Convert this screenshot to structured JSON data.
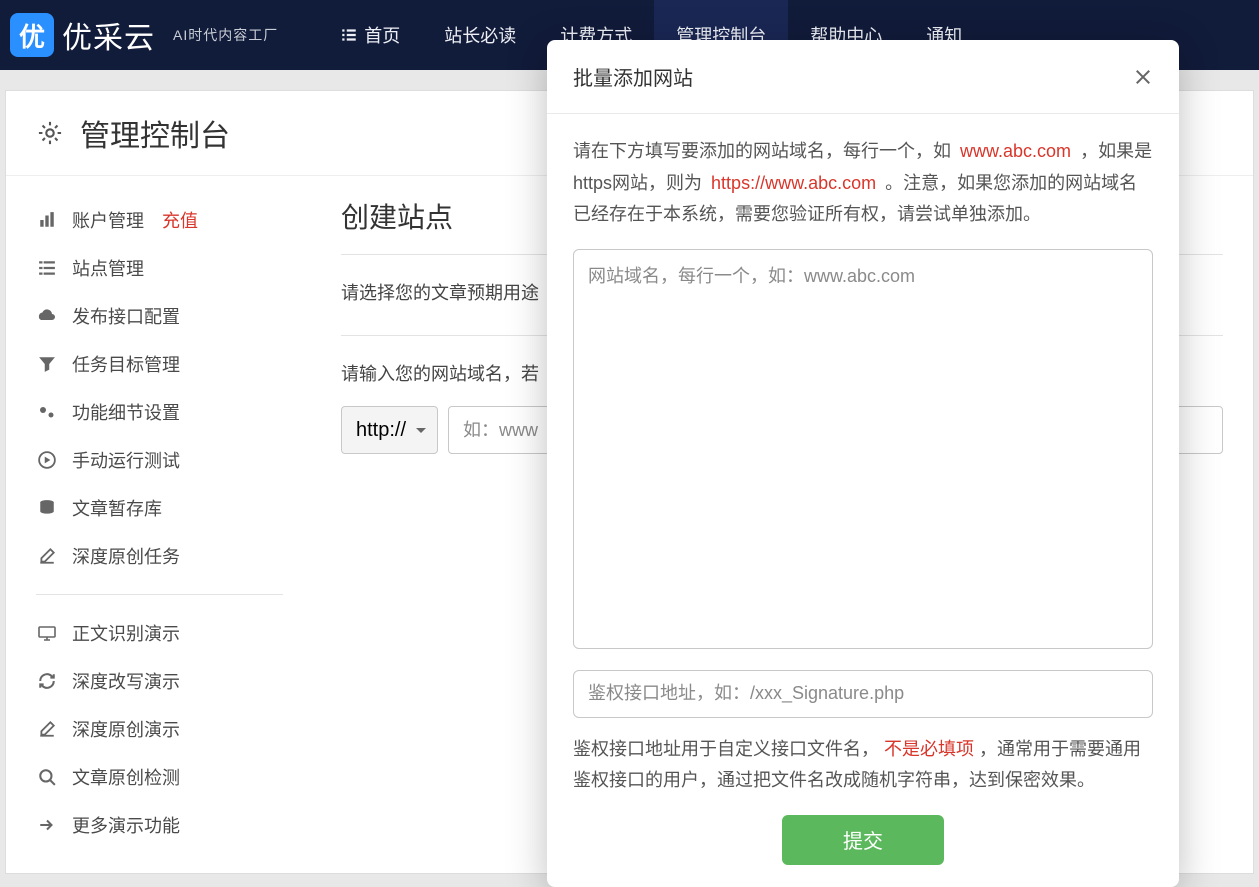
{
  "brand": {
    "badge": "优",
    "name": "优采云",
    "sub": "AI时代内容工厂"
  },
  "nav": {
    "items": [
      {
        "label": "首页"
      },
      {
        "label": "站长必读"
      },
      {
        "label": "计费方式"
      },
      {
        "label": "管理控制台"
      },
      {
        "label": "帮助中心"
      },
      {
        "label": "通知"
      }
    ],
    "active_index": 3
  },
  "page": {
    "title": "管理控制台"
  },
  "sidebar": {
    "groups": [
      [
        {
          "label": "账户管理",
          "badge": "充值",
          "icon": "bar-chart"
        },
        {
          "label": "站点管理",
          "icon": "list"
        },
        {
          "label": "发布接口配置",
          "icon": "cloud"
        },
        {
          "label": "任务目标管理",
          "icon": "filter"
        },
        {
          "label": "功能细节设置",
          "icon": "gears"
        },
        {
          "label": "手动运行测试",
          "icon": "play"
        },
        {
          "label": "文章暂存库",
          "icon": "db"
        },
        {
          "label": "深度原创任务",
          "icon": "edit"
        }
      ],
      [
        {
          "label": "正文识别演示",
          "icon": "monitor"
        },
        {
          "label": "深度改写演示",
          "icon": "refresh"
        },
        {
          "label": "深度原创演示",
          "icon": "edit"
        },
        {
          "label": "文章原创检测",
          "icon": "search"
        },
        {
          "label": "更多演示功能",
          "icon": "share"
        }
      ]
    ]
  },
  "main": {
    "heading": "创建站点",
    "purpose_label": "请选择您的文章预期用途",
    "domain_label": "请输入您的网站域名，若",
    "protocol_selected": "http://",
    "domain_placeholder": "如：www"
  },
  "modal": {
    "title": "批量添加网站",
    "desc_pre": "请在下方填写要添加的网站域名，每行一个，如",
    "example1": "www.abc.com",
    "desc_mid": "，如果是https网站，则为",
    "example2": "https://www.abc.com",
    "desc_post": "。注意，如果您添加的网站域名已经存在于本系统，需要您验证所有权，请尝试单独添加。",
    "textarea_placeholder": "网站域名，每行一个，如：www.abc.com",
    "auth_placeholder": "鉴权接口地址，如：/xxx_Signature.php",
    "note_pre": "鉴权接口地址用于自定义接口文件名，",
    "note_red": "不是必填项",
    "note_post": "，通常用于需要通用鉴权接口的用户，通过把文件名改成随机字符串，达到保密效果。",
    "submit": "提交"
  }
}
